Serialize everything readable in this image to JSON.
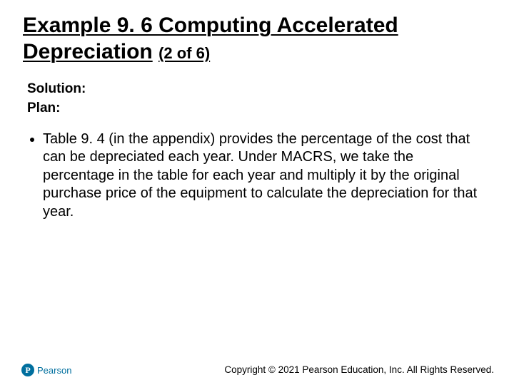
{
  "title": {
    "main": "Example 9. 6 Computing Accelerated Depreciation",
    "paren": "(2 of 6)"
  },
  "subheading": {
    "line1": "Solution:",
    "line2": "Plan:"
  },
  "bullets": [
    "Table 9. 4 (in the appendix) provides the percentage of the cost that can be depreciated each year. Under MACRS, we take the percentage in the table for each year and multiply it by the original purchase price of the equipment to calculate the depreciation for that year."
  ],
  "logo": {
    "badge": "P",
    "name": "Pearson"
  },
  "copyright": "Copyright © 2021 Pearson Education, Inc. All Rights Reserved."
}
